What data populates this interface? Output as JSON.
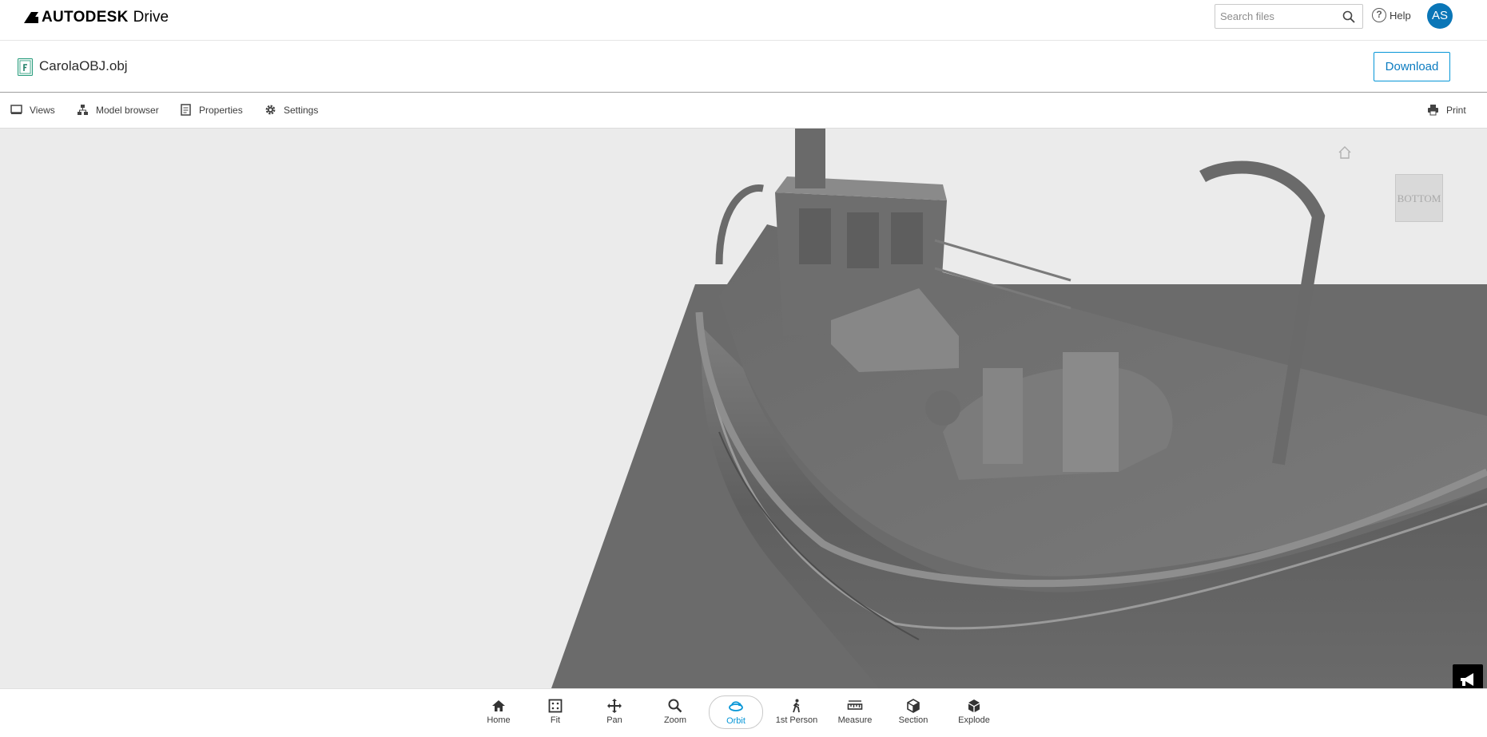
{
  "header": {
    "brand_name": "AUTODESK",
    "product_name": "Drive",
    "search_placeholder": "Search files",
    "help_label": "Help",
    "avatar_initials": "AS"
  },
  "file": {
    "name": "CarolaOBJ.obj",
    "download_label": "Download"
  },
  "viewer_toolbar": {
    "views": "Views",
    "model_browser": "Model browser",
    "properties": "Properties",
    "settings": "Settings",
    "print": "Print"
  },
  "viewport": {
    "viewcube_face": "BOTTOM"
  },
  "tools": [
    {
      "label": "Home",
      "icon": "home-icon",
      "active": false
    },
    {
      "label": "Fit",
      "icon": "fit-icon",
      "active": false
    },
    {
      "label": "Pan",
      "icon": "pan-icon",
      "active": false
    },
    {
      "label": "Zoom",
      "icon": "zoom-icon",
      "active": false
    },
    {
      "label": "Orbit",
      "icon": "orbit-icon",
      "active": true
    },
    {
      "label": "1st Person",
      "icon": "first-person-icon",
      "active": false
    },
    {
      "label": "Measure",
      "icon": "measure-icon",
      "active": false
    },
    {
      "label": "Section",
      "icon": "section-icon",
      "active": false
    },
    {
      "label": "Explode",
      "icon": "explode-icon",
      "active": false
    }
  ],
  "colors": {
    "accent": "#0696d7",
    "avatar_bg": "#0a76b7",
    "viewport_bg": "#ebebeb"
  }
}
